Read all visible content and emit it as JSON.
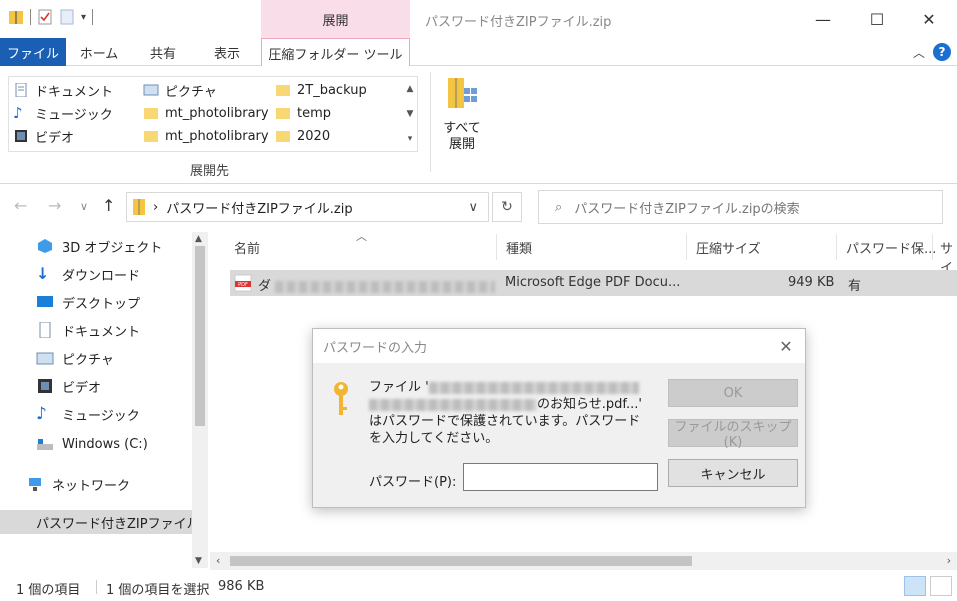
{
  "titlebar": {
    "context_tab_title": "展開",
    "window_title": "パスワード付きZIPファイル.zip",
    "minimize": "—",
    "maximize": "☐",
    "close": "✕"
  },
  "ribbon_tabs": {
    "file": "ファイル",
    "home": "ホーム",
    "share": "共有",
    "view": "表示",
    "compressed_tools": "圧縮フォルダー ツール"
  },
  "ribbon": {
    "destinations": [
      {
        "label": "ドキュメント",
        "icon": "document-icon"
      },
      {
        "label": "ミュージック",
        "icon": "music-icon"
      },
      {
        "label": "ビデオ",
        "icon": "video-icon"
      },
      {
        "label": "ピクチャ",
        "icon": "picture-icon"
      },
      {
        "label": "mt_photolibrary",
        "icon": "folder-icon"
      },
      {
        "label": "mt_photolibrary",
        "icon": "folder-icon"
      },
      {
        "label": "2T_backup",
        "icon": "folder-icon"
      },
      {
        "label": "temp",
        "icon": "folder-icon"
      },
      {
        "label": "2020",
        "icon": "folder-icon"
      }
    ],
    "group_label": "展開先",
    "extract_all_line1": "すべて",
    "extract_all_line2": "展開"
  },
  "address": {
    "path": "パスワード付きZIPファイル.zip",
    "search_placeholder": "パスワード付きZIPファイル.zipの検索"
  },
  "nav_pane": {
    "items": [
      {
        "label": "3D オブジェクト",
        "icon": "3d-objects-icon"
      },
      {
        "label": "ダウンロード",
        "icon": "download-icon"
      },
      {
        "label": "デスクトップ",
        "icon": "desktop-icon"
      },
      {
        "label": "ドキュメント",
        "icon": "document-icon"
      },
      {
        "label": "ピクチャ",
        "icon": "picture-icon"
      },
      {
        "label": "ビデオ",
        "icon": "video-icon"
      },
      {
        "label": "ミュージック",
        "icon": "music-icon"
      },
      {
        "label": "Windows (C:)",
        "icon": "drive-icon"
      },
      {
        "label": "ネットワーク",
        "icon": "network-icon"
      },
      {
        "label": "パスワード付きZIPファイル",
        "icon": "zip-folder-icon"
      }
    ]
  },
  "file_list": {
    "columns": [
      "名前",
      "種類",
      "圧縮サイズ",
      "パスワード保...",
      "サイ"
    ],
    "rows": [
      {
        "name_prefix": "ダ",
        "type": "Microsoft Edge PDF Docu...",
        "compressed_size": "949 KB",
        "password": "有"
      }
    ]
  },
  "status": {
    "count": "1 個の項目",
    "selected": "1 個の項目を選択",
    "size": "986 KB"
  },
  "dialog": {
    "title": "パスワードの入力",
    "msg_line1_prefix": "ファイル '",
    "msg_line2_suffix": "のお知らせ.pdf...'",
    "msg_line3": "はパスワードで保護されています。パスワードを入力してください。",
    "password_label": "パスワード(P):",
    "password_value": "",
    "ok": "OK",
    "skip": "ファイルのスキップ(K)",
    "cancel": "キャンセル"
  },
  "colors": {
    "file_tab": "#1a5fb4",
    "context_tab": "#f9dde8",
    "selection": "#d9d9d9"
  }
}
